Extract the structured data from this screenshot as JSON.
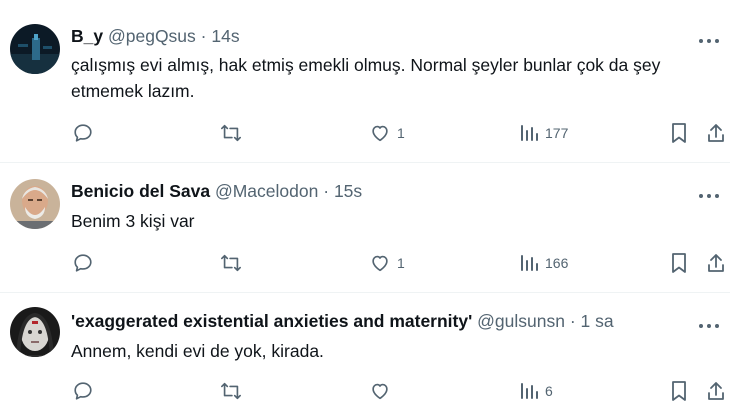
{
  "tweets": [
    {
      "name": "B_y",
      "handle": "@pegQsus",
      "separator": "·",
      "time": "14s",
      "text": "çalışmış evi almış, hak etmiş emekli olmuş. Normal şeyler bunlar çok da şey etmemek lazım.",
      "likes": "1",
      "views": "177"
    },
    {
      "name": "Benicio del Sava",
      "handle": "@Macelodon",
      "separator": "·",
      "time": "15s",
      "text": "Benim 3 kişi var",
      "likes": "1",
      "views": "166"
    },
    {
      "name": "'exaggerated existential anxieties and maternity'",
      "handle": "@gulsunsn",
      "separator": "·",
      "time": "1 sa",
      "text": "Annem, kendi evi de yok, kirada.",
      "likes": "",
      "views": "6"
    }
  ],
  "icons": {
    "reply": "reply-icon",
    "retweet": "retweet-icon",
    "like": "heart-icon",
    "views": "views-icon",
    "bookmark": "bookmark-icon",
    "share": "share-icon",
    "more": "more-icon"
  },
  "colors": {
    "text": "#0f1419",
    "secondary": "#536471",
    "divider": "#eff3f4"
  }
}
